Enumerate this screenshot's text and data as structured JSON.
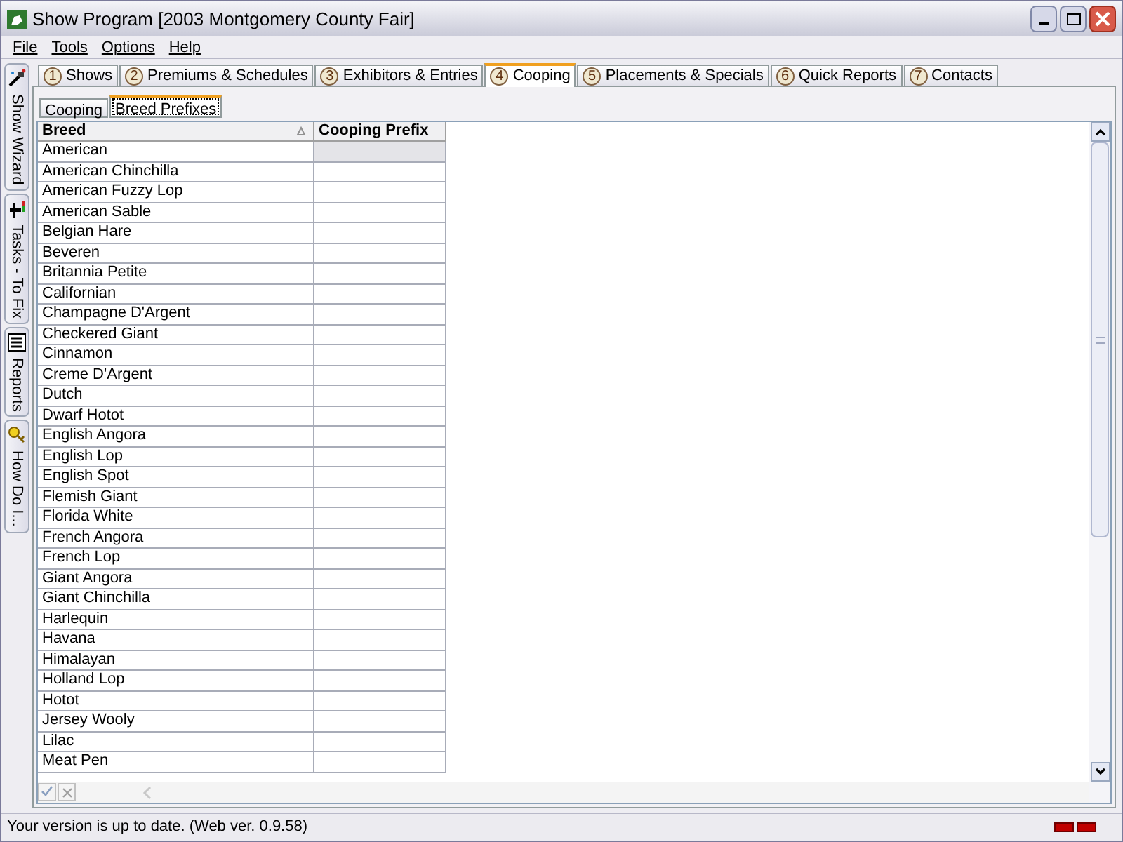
{
  "window": {
    "title": "Show Program [2003 Montgomery County Fair]"
  },
  "menu": [
    "File",
    "Tools",
    "Options",
    "Help"
  ],
  "side_tabs": [
    {
      "label": "Show Wizard",
      "kind": "wizard"
    },
    {
      "label": "Tasks - To Fix",
      "kind": "tasks"
    },
    {
      "label": "Reports",
      "kind": "reports"
    },
    {
      "label": "How Do I...",
      "kind": "help"
    }
  ],
  "tabs": [
    {
      "number": "1",
      "label": "Shows",
      "selected": false
    },
    {
      "number": "2",
      "label": "Premiums & Schedules",
      "selected": false
    },
    {
      "number": "3",
      "label": "Exhibitors & Entries",
      "selected": false
    },
    {
      "number": "4",
      "label": "Cooping",
      "selected": true
    },
    {
      "number": "5",
      "label": "Placements & Specials",
      "selected": false
    },
    {
      "number": "6",
      "label": "Quick Reports",
      "selected": false
    },
    {
      "number": "7",
      "label": "Contacts",
      "selected": false
    }
  ],
  "sub_tabs": [
    {
      "label": "Cooping",
      "selected": false
    },
    {
      "label": "Breed Prefixes",
      "selected": true
    }
  ],
  "table": {
    "columns": [
      "Breed",
      "Cooping Prefix"
    ],
    "rows": [
      {
        "breed": "American",
        "selected": true
      },
      {
        "breed": "American Chinchilla",
        "selected": false
      },
      {
        "breed": "American Fuzzy Lop",
        "selected": false
      },
      {
        "breed": "American Sable",
        "selected": false
      },
      {
        "breed": "Belgian Hare",
        "selected": false
      },
      {
        "breed": "Beveren",
        "selected": false
      },
      {
        "breed": "Britannia Petite",
        "selected": false
      },
      {
        "breed": "Californian",
        "selected": false
      },
      {
        "breed": "Champagne D'Argent",
        "selected": false
      },
      {
        "breed": "Checkered Giant",
        "selected": false
      },
      {
        "breed": "Cinnamon",
        "selected": false
      },
      {
        "breed": "Creme D'Argent",
        "selected": false
      },
      {
        "breed": "Dutch",
        "selected": false
      },
      {
        "breed": "Dwarf Hotot",
        "selected": false
      },
      {
        "breed": "English Angora",
        "selected": false
      },
      {
        "breed": "English Lop",
        "selected": false
      },
      {
        "breed": "English Spot",
        "selected": false
      },
      {
        "breed": "Flemish Giant",
        "selected": false
      },
      {
        "breed": "Florida White",
        "selected": false
      },
      {
        "breed": "French Angora",
        "selected": false
      },
      {
        "breed": "French Lop",
        "selected": false
      },
      {
        "breed": "Giant Angora",
        "selected": false
      },
      {
        "breed": "Giant Chinchilla",
        "selected": false
      },
      {
        "breed": "Harlequin",
        "selected": false
      },
      {
        "breed": "Havana",
        "selected": false
      },
      {
        "breed": "Himalayan",
        "selected": false
      },
      {
        "breed": "Holland Lop",
        "selected": false
      },
      {
        "breed": "Hotot",
        "selected": false
      },
      {
        "breed": "Jersey Wooly",
        "selected": false
      },
      {
        "breed": "Lilac",
        "selected": false
      },
      {
        "breed": "Meat Pen",
        "selected": false
      }
    ]
  },
  "status_bar": {
    "text": "Your version is up to date. (Web ver. 0.9.58)"
  }
}
